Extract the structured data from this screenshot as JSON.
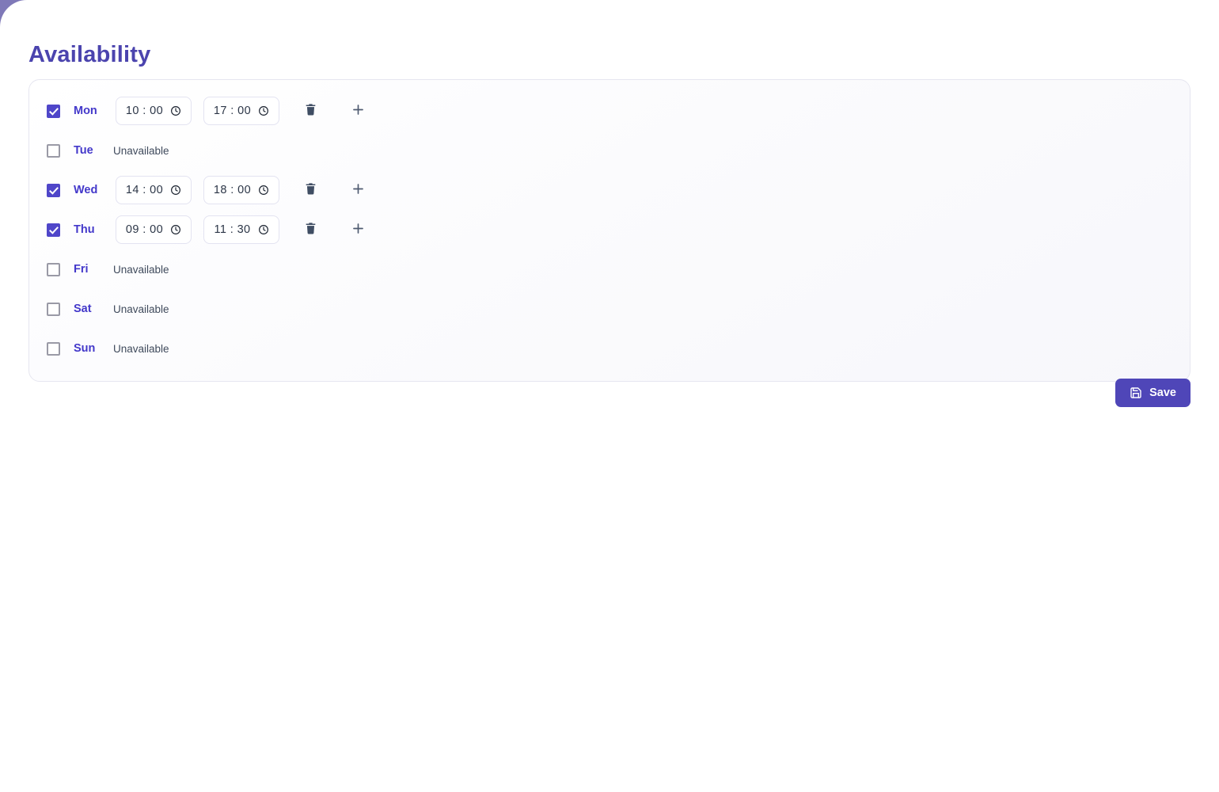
{
  "page": {
    "title": "Availability"
  },
  "colors": {
    "accent": "#4f46c9",
    "title": "#4b44ae",
    "day_label": "#4338ca",
    "save_button": "#4f46b8",
    "card_border": "#e6e6f0",
    "field_border": "#e3e3f1",
    "muted_text": "#3f4a5c",
    "page_background": "#7f79b8"
  },
  "availability": {
    "unavailable_label": "Unavailable",
    "icons": {
      "clock": "clock-icon",
      "delete": "trash-icon",
      "add": "plus-icon",
      "checkbox_checked": "checkbox-checked-icon",
      "checkbox_unchecked": "checkbox-unchecked-icon"
    },
    "days": [
      {
        "id": "mon",
        "label": "Mon",
        "enabled": true,
        "start": "10 : 00",
        "end": "17 : 00"
      },
      {
        "id": "tue",
        "label": "Tue",
        "enabled": false,
        "start": null,
        "end": null
      },
      {
        "id": "wed",
        "label": "Wed",
        "enabled": true,
        "start": "14 : 00",
        "end": "18 : 00"
      },
      {
        "id": "thu",
        "label": "Thu",
        "enabled": true,
        "start": "09 : 00",
        "end": "11 : 30"
      },
      {
        "id": "fri",
        "label": "Fri",
        "enabled": false,
        "start": null,
        "end": null
      },
      {
        "id": "sat",
        "label": "Sat",
        "enabled": false,
        "start": null,
        "end": null
      },
      {
        "id": "sun",
        "label": "Sun",
        "enabled": false,
        "start": null,
        "end": null
      }
    ]
  },
  "footer": {
    "save_label": "Save",
    "save_icon": "save-icon"
  }
}
